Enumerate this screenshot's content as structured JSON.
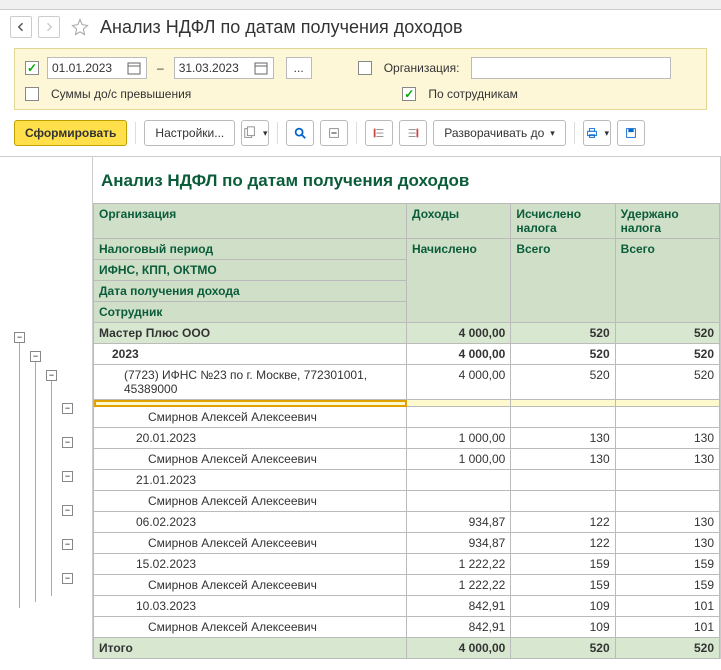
{
  "title": "Анализ НДФЛ по датам получения доходов",
  "filters": {
    "date_enabled": true,
    "date_from": "01.01.2023",
    "date_to": "31.03.2023",
    "dash": "–",
    "org_label": "Организация:",
    "sums_checked": false,
    "sums_label": "Суммы до/с превышения",
    "by_emp_checked": true,
    "by_emp_label": "По сотрудникам"
  },
  "toolbar": {
    "generate": "Сформировать",
    "settings": "Настройки...",
    "expand": "Разворачивать до",
    "dots": "..."
  },
  "report": {
    "title": "Анализ НДФЛ по датам получения доходов",
    "headers": {
      "org": "Организация",
      "income": "Доходы",
      "calc_tax": "Исчислено налога",
      "withheld_tax": "Удержано налога",
      "tax_period": "Налоговый период",
      "accrued": "Начислено",
      "total": "Всего",
      "ifns": "ИФНС, КПП, ОКТМО",
      "income_date": "Дата получения дохода",
      "employee": "Сотрудник"
    },
    "rows": [
      {
        "lvl": 0,
        "label": "Мастер Плюс ООО",
        "c1": "4 000,00",
        "c2": "520",
        "c3": "520"
      },
      {
        "lvl": 1,
        "label": "2023",
        "c1": "4 000,00",
        "c2": "520",
        "c3": "520"
      },
      {
        "lvl": 2,
        "label": "(7723) ИФНС №23 по г. Москве, 772301001, 45389000",
        "c1": "4 000,00",
        "c2": "520",
        "c3": "520"
      },
      {
        "lvl": 3,
        "label": "",
        "sel": true,
        "c1": "",
        "c2": "",
        "c3": ""
      },
      {
        "lvl": 4,
        "label": "Смирнов Алексей Алексеевич",
        "c1": "",
        "c2": "",
        "c3": ""
      },
      {
        "lvl": 3,
        "label": "20.01.2023",
        "c1": "1 000,00",
        "c2": "130",
        "c3": "130"
      },
      {
        "lvl": 4,
        "label": "Смирнов Алексей Алексеевич",
        "c1": "1 000,00",
        "c2": "130",
        "c3": "130"
      },
      {
        "lvl": 3,
        "label": "21.01.2023",
        "c1": "",
        "c2": "",
        "c3": ""
      },
      {
        "lvl": 4,
        "label": "Смирнов Алексей Алексеевич",
        "c1": "",
        "c2": "",
        "c3": ""
      },
      {
        "lvl": 3,
        "label": "06.02.2023",
        "c1": "934,87",
        "c2": "122",
        "c3": "130"
      },
      {
        "lvl": 4,
        "label": "Смирнов Алексей Алексеевич",
        "c1": "934,87",
        "c2": "122",
        "c3": "130"
      },
      {
        "lvl": 3,
        "label": "15.02.2023",
        "c1": "1 222,22",
        "c2": "159",
        "c3": "159"
      },
      {
        "lvl": 4,
        "label": "Смирнов Алексей Алексеевич",
        "c1": "1 222,22",
        "c2": "159",
        "c3": "159"
      },
      {
        "lvl": 3,
        "label": "10.03.2023",
        "c1": "842,91",
        "c2": "109",
        "c3": "101"
      },
      {
        "lvl": 4,
        "label": "Смирнов Алексей Алексеевич",
        "c1": "842,91",
        "c2": "109",
        "c3": "101"
      }
    ],
    "total_label": "Итого",
    "total": {
      "c1": "4 000,00",
      "c2": "520",
      "c3": "520"
    }
  }
}
